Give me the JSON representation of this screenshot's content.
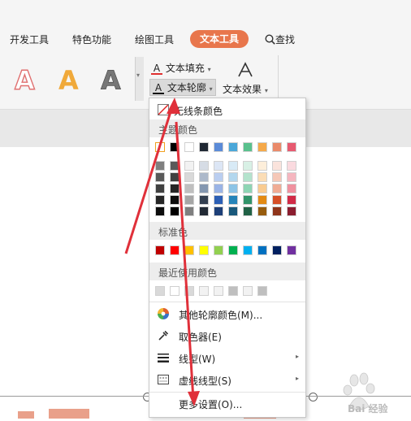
{
  "tabs": [
    "开发工具",
    "特色功能",
    "绘图工具",
    "文本工具",
    "查找"
  ],
  "ribbon": {
    "fill_label": "文本填充",
    "outline_label": "文本轮廓",
    "effect_label": "文本效果",
    "style_letter": "A"
  },
  "menu": {
    "no_line": "无线条颜色",
    "theme_colors": "主题颜色",
    "standard_colors": "标准色",
    "recent_colors": "最近使用颜色",
    "other_colors": "其他轮廓颜色(M)...",
    "eyedropper": "取色器(E)",
    "line_type": "线型(W)",
    "dash_type": "虚线线型(S)",
    "more_settings": "更多设置(O)...",
    "theme_top_row": [
      "#ffffff",
      "#000000",
      "#ffffff",
      "#1f2733",
      "#5b8bd8",
      "#4aa7d9",
      "#59c18d",
      "#f5a94a",
      "#ea8a6a",
      "#e75a70"
    ],
    "theme_shades": [
      [
        "#7f7f7f",
        "#595959",
        "#f2f2f2",
        "#d6dce5",
        "#dce6f5",
        "#d8eaf6",
        "#d8f0e5",
        "#fdeeda",
        "#fae3dc",
        "#fadadf"
      ],
      [
        "#595959",
        "#404040",
        "#d9d9d9",
        "#adb9ca",
        "#bacef0",
        "#b3d7ee",
        "#b4e3cd",
        "#fbddb6",
        "#f5c8b8",
        "#f5b6bf"
      ],
      [
        "#404040",
        "#262626",
        "#bfbfbf",
        "#8497b0",
        "#9ab4e6",
        "#8dc4e6",
        "#8ed5b4",
        "#f9cb91",
        "#f0ac95",
        "#f0919f"
      ],
      [
        "#262626",
        "#0d0d0d",
        "#a6a6a6",
        "#333f50",
        "#2c5fb5",
        "#2684b9",
        "#32946a",
        "#e38a14",
        "#d64f28",
        "#d12b47"
      ],
      [
        "#0d0d0d",
        "#000000",
        "#7f7f7f",
        "#222a35",
        "#1d3f78",
        "#19587b",
        "#216246",
        "#975c0d",
        "#8f351b",
        "#8b1d2f"
      ]
    ],
    "standard": [
      "#c00000",
      "#ff0000",
      "#ffc000",
      "#ffff00",
      "#92d050",
      "#00b050",
      "#00b0f0",
      "#0070c0",
      "#002060",
      "#7030a0"
    ],
    "recent": [
      "#d9d9d9",
      "#ffffff",
      "#d9d9d9",
      "#f2f2f2",
      "#f2f2f2",
      "#bfbfbf",
      "#f2f2f2",
      "#bfbfbf"
    ]
  },
  "watermark": "Bai 经验"
}
